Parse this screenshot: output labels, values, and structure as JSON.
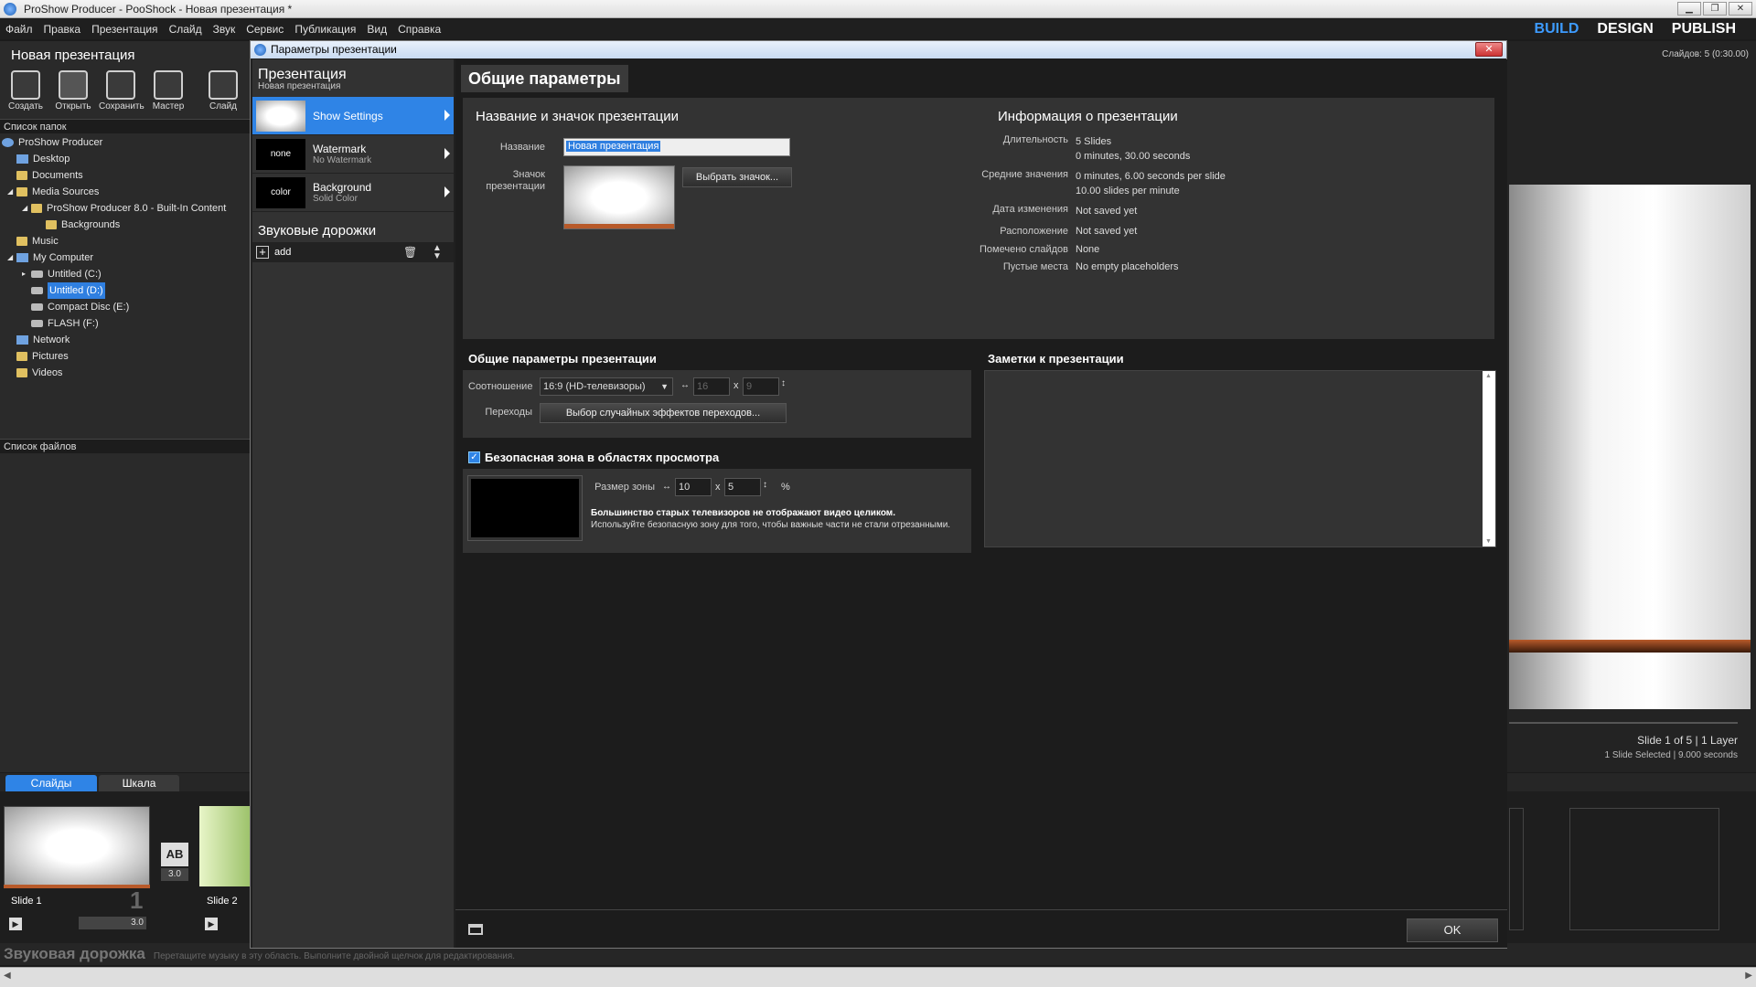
{
  "window": {
    "title": "ProShow Producer - PooShock - Новая презентация *",
    "min": "▁",
    "max": "❐",
    "close": "✕"
  },
  "menu": [
    "Файл",
    "Правка",
    "Презентация",
    "Слайд",
    "Звук",
    "Сервис",
    "Публикация",
    "Вид",
    "Справка"
  ],
  "modes": [
    "BUILD",
    "DESIGN",
    "PUBLISH"
  ],
  "status_slides": "Слайдов: 5 (0:30.00)",
  "left": {
    "title": "Новая презентация",
    "toolbar": [
      "Создать",
      "Открыть",
      "Сохранить",
      "Мастер",
      "Слайд"
    ],
    "folders_header": "Список папок",
    "tree": [
      {
        "label": "ProShow Producer",
        "depth": 0,
        "icon": "app"
      },
      {
        "label": "Desktop",
        "depth": 1,
        "icon": "pc"
      },
      {
        "label": "Documents",
        "depth": 1,
        "icon": "folder"
      },
      {
        "label": "Media Sources",
        "depth": 1,
        "icon": "folder"
      },
      {
        "label": "ProShow Producer 8.0 - Built-In Content",
        "depth": 2,
        "icon": "folder"
      },
      {
        "label": "Backgrounds",
        "depth": 3,
        "icon": "folder"
      },
      {
        "label": "Music",
        "depth": 1,
        "icon": "folder"
      },
      {
        "label": "My Computer",
        "depth": 1,
        "icon": "pc"
      },
      {
        "label": "Untitled (C:)",
        "depth": 2,
        "icon": "drive"
      },
      {
        "label": "Untitled (D:)",
        "depth": 2,
        "icon": "drive",
        "selected": true
      },
      {
        "label": "Compact Disc (E:)",
        "depth": 2,
        "icon": "drive"
      },
      {
        "label": "FLASH (F:)",
        "depth": 2,
        "icon": "drive"
      },
      {
        "label": "Network",
        "depth": 1,
        "icon": "pc"
      },
      {
        "label": "Pictures",
        "depth": 1,
        "icon": "folder"
      },
      {
        "label": "Videos",
        "depth": 1,
        "icon": "folder"
      }
    ],
    "files_header": "Список файлов"
  },
  "bottom": {
    "tabs": [
      "Слайды",
      "Шкала"
    ],
    "slide1": {
      "name": "Slide 1",
      "num": "1",
      "dur": "3.0"
    },
    "transition": {
      "label": "AB",
      "dur": "3.0"
    },
    "slide2": {
      "name": "Slide 2"
    },
    "sound_title": "Звуковая дорожка",
    "sound_hint": "Перетащите музыку в эту область. Выполните двойной щелчок для редактирования."
  },
  "right": {
    "slide_info": "Slide 1 of 5  |  1 Layer",
    "slide_sel": "1 Slide Selected  |  9.000 seconds"
  },
  "dialog": {
    "title": "Параметры презентации",
    "close": "✕",
    "nav_head": "Презентация",
    "nav_sub": "Новая презентация",
    "nav_items": [
      {
        "title": "Show Settings",
        "sub": "",
        "swatch": ""
      },
      {
        "title": "Watermark",
        "sub": "No Watermark",
        "swatch": "none"
      },
      {
        "title": "Background",
        "sub": "Solid Color",
        "swatch": "color"
      }
    ],
    "sound_head": "Звуковые дорожки",
    "add_label": "add",
    "main_title": "Общие параметры",
    "name_section": "Название и значок презентации",
    "name_label": "Название",
    "name_value": "Новая презентация",
    "icon_label": "Значок презентации",
    "choose_icon": "Выбрать значок...",
    "info_section": "Информация о презентации",
    "info": [
      {
        "label": "Длительность",
        "lines": [
          "5 Slides",
          "0 minutes, 30.00 seconds"
        ]
      },
      {
        "label": "Средние значения",
        "lines": [
          "0 minutes, 6.00 seconds per slide",
          "10.00 slides per minute"
        ]
      },
      {
        "label": "Дата изменения",
        "lines": [
          "Not saved yet"
        ]
      },
      {
        "label": "Расположение",
        "lines": [
          "Not saved yet"
        ]
      },
      {
        "label": "Помечено слайдов",
        "lines": [
          "None"
        ]
      },
      {
        "label": "Пустые места",
        "lines": [
          "No empty placeholders"
        ]
      }
    ],
    "general_section": "Общие параметры презентации",
    "ratio_label": "Соотношение",
    "ratio_value": "16:9 (HD-телевизоры)",
    "ratio_w": "16",
    "ratio_h": "9",
    "trans_label": "Переходы",
    "trans_button": "Выбор случайных эффектов переходов...",
    "notes_section": "Заметки к презентации",
    "safe_label": "Безопасная зона в областях просмотра",
    "zone_label": "Размер зоны",
    "zone_w": "10",
    "zone_h": "5",
    "percent": "%",
    "times": "x",
    "safe_text1": "Большинство старых телевизоров не отображают видео целиком.",
    "safe_text2": "Используйте безопасную зону для того, чтобы важные части не стали отрезанными.",
    "ok": "OK"
  }
}
